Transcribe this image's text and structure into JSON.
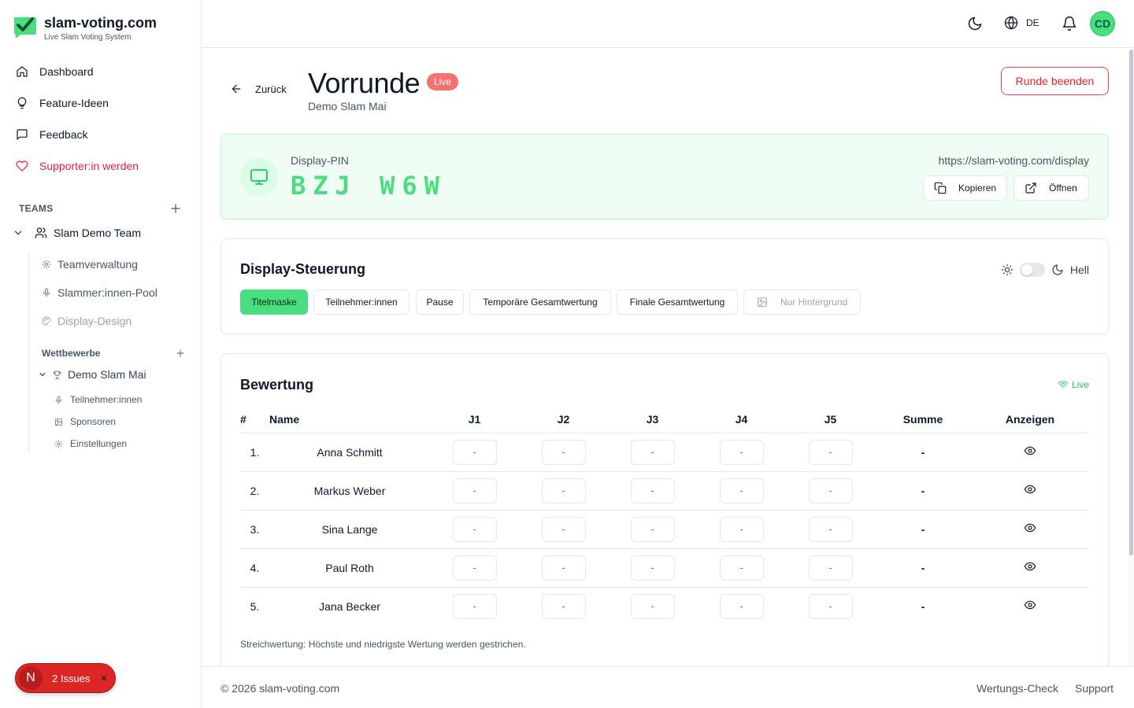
{
  "brand": {
    "name": "slam-voting.com",
    "tagline": "Live Slam Voting System"
  },
  "nav": {
    "dashboard": "Dashboard",
    "feature_ideas": "Feature-Ideen",
    "feedback": "Feedback",
    "supporter": "Supporter:in werden"
  },
  "teams": {
    "label": "TEAMS",
    "team_name": "Slam Demo Team",
    "items": [
      "Teamverwaltung",
      "Slammer:innen-Pool",
      "Display-Design"
    ],
    "competitions_label": "Wettbewerbe",
    "competition": {
      "name": "Demo Slam Mai",
      "items": [
        "Teilnehmer:innen",
        "Sponsoren",
        "Einstellungen"
      ]
    }
  },
  "issues": {
    "letter": "N",
    "text": "2 Issues"
  },
  "topbar": {
    "language": "DE",
    "avatar": "CD"
  },
  "page": {
    "back": "Zurück",
    "title": "Vorrunde",
    "badge": "Live",
    "subtitle": "Demo Slam Mai",
    "end_button": "Runde beenden"
  },
  "pin": {
    "label": "Display-PIN",
    "code": "BZJ W6W",
    "url": "https://slam-voting.com/display",
    "copy": "Kopieren",
    "open": "Öffnen"
  },
  "display_control": {
    "title": "Display-Steuerung",
    "theme_label": "Hell",
    "modes": [
      "Titelmaske",
      "Teilnehmer:innen",
      "Pause",
      "Temporäre Gesamtwertung",
      "Finale Gesamtwertung",
      "Nur Hintergrund"
    ],
    "active_mode": "Titelmaske"
  },
  "scoring": {
    "title": "Bewertung",
    "live": "Live",
    "columns": [
      "#",
      "Name",
      "J1",
      "J2",
      "J3",
      "J4",
      "J5",
      "Summe",
      "Anzeigen"
    ],
    "rows": [
      {
        "num": "1.",
        "name": "Anna Schmitt",
        "scores": [
          "-",
          "-",
          "-",
          "-",
          "-"
        ],
        "sum": "-"
      },
      {
        "num": "2.",
        "name": "Markus Weber",
        "scores": [
          "-",
          "-",
          "-",
          "-",
          "-"
        ],
        "sum": "-"
      },
      {
        "num": "3.",
        "name": "Sina Lange",
        "scores": [
          "-",
          "-",
          "-",
          "-",
          "-"
        ],
        "sum": "-"
      },
      {
        "num": "4.",
        "name": "Paul Roth",
        "scores": [
          "-",
          "-",
          "-",
          "-",
          "-"
        ],
        "sum": "-"
      },
      {
        "num": "5.",
        "name": "Jana Becker",
        "scores": [
          "-",
          "-",
          "-",
          "-",
          "-"
        ],
        "sum": "-"
      }
    ],
    "note": "Streichwertung: Höchste und niedrigste Wertung werden gestrichen."
  },
  "footer": {
    "copyright": "© 2026 slam-voting.com",
    "links": [
      "Wertungs-Check",
      "Support"
    ]
  },
  "colors": {
    "accent": "#4ade80",
    "danger": "#ef4444",
    "rose": "#e11d48"
  }
}
